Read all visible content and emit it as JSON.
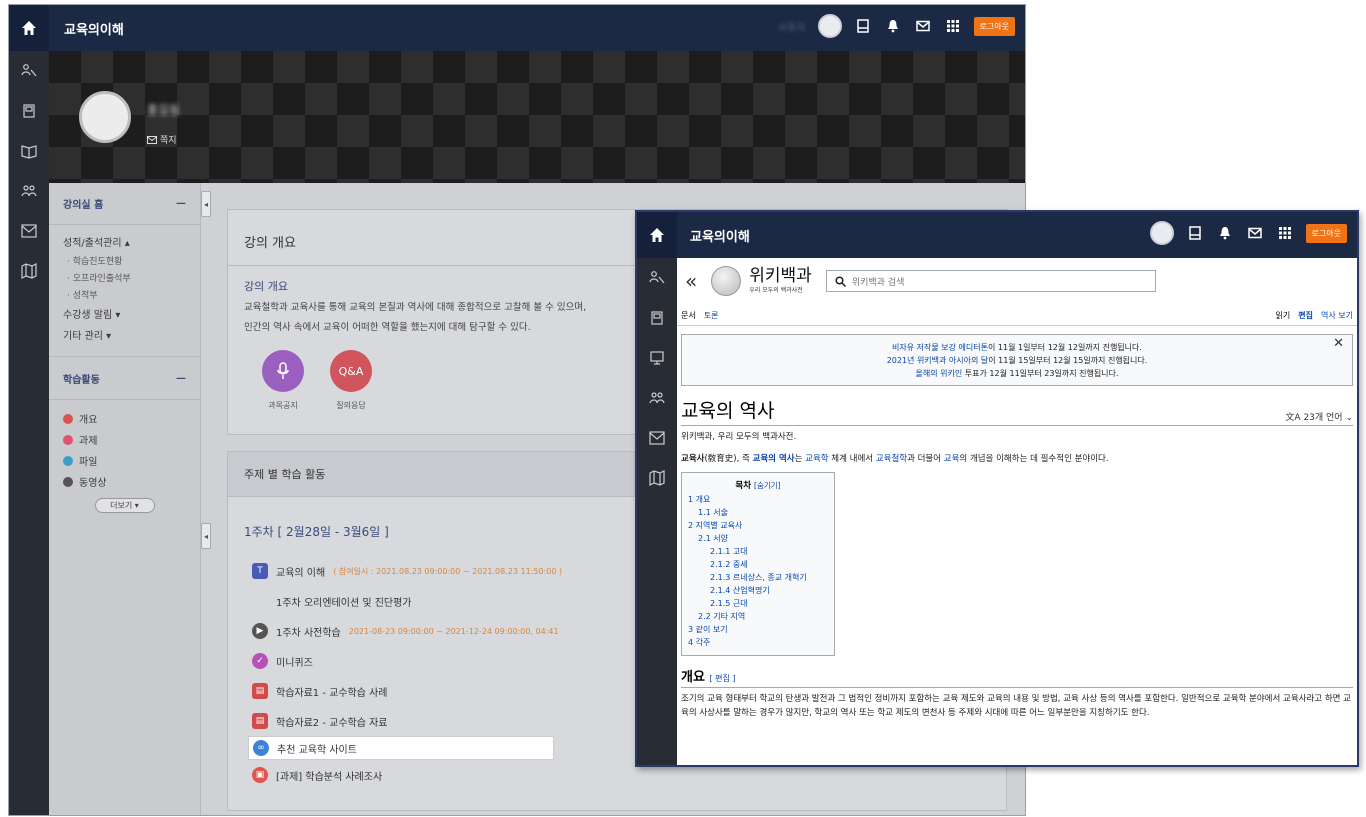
{
  "lms": {
    "app_title": "교육의이해",
    "user_name": "사용자",
    "logout_label": "로그아웃",
    "banner": {
      "name": "홍길동",
      "note_label": "쪽지"
    },
    "nav": {
      "home_label": "강의실 홈",
      "home_toggle": "—",
      "grades_label": "성적/출석관리 ▴",
      "grades_sub": [
        "· 학습진도현황",
        "· 오프라인출석부",
        "· 성적부"
      ],
      "notify_label": "수강생 알림 ▾",
      "etc_label": "기타 관리 ▾",
      "activities_label": "학습활동",
      "activities_toggle": "—",
      "activities": [
        "개요",
        "과제",
        "파일",
        "동영상"
      ],
      "more_label": "더보기 ▾"
    },
    "overview": {
      "title": "강의 개요",
      "subtitle": "강의 개요",
      "text1": "교육철학과 교육사를 통해 교육의 본질과 역사에 대해 종합적으로 고찰해 볼 수 있으며,",
      "text2": "인간의 역사 속에서 교육이 어떠한 역할을 했는지에 대해 탐구할 수 있다.",
      "btn1_label": "과목공지",
      "btn2_text": "Q&A",
      "btn2_label": "질의응답"
    },
    "weekly": {
      "header": "주제 별 학습 활동",
      "week": "1주차 [ 2월28일 - 3월6일 ]",
      "items": {
        "i1_title": "교육의 이해",
        "i1_meta": "( 참여일시 : 2021.08.23 09:00:00 ~ 2021.08.23 11:50:00 )",
        "i1_sub": "1주차 오리엔테이션 및 진단평가",
        "i2_title": "1주차 사전학습",
        "i2_meta": "2021-08-23 09:00:00 ~ 2021-12-24 09:00:00, 04:41",
        "i3_title": "미니퀴즈",
        "i4_title": "학습자료1 - 교수학습 사례",
        "i5_title": "학습자료2 - 교수학습 자료",
        "i6_title": "추천 교육학 사이트",
        "i7_title": "[과제] 학습분석 사례조사"
      }
    }
  },
  "front": {
    "app_title": "교육의이해",
    "logout_label": "로그아웃",
    "wiki": {
      "back": "«",
      "title": "위키백과",
      "subtitle": "우리 모두의 백과사전",
      "search_placeholder": "위키백과 검색",
      "tab_doc": "문서",
      "tab_talk": "토론",
      "tab_read": "읽기",
      "tab_edit": "편집",
      "tab_history": "역사 보기",
      "notice1_link": "비자유 저작물 보강 에디터톤",
      "notice1_rest": "이 11월 1일부터 12월 12일까지 진행됩니다.",
      "notice2_link": "2021년 위키백과 아시아의 달",
      "notice2_rest": "이 11월 15일부터 12월 15일까지 진행됩니다.",
      "notice3_link": "올해의 위키인",
      "notice3_rest": " 투표가 12월 11일부터 23일까지 진행됩니다.",
      "heading": "교육의 역사",
      "lang": "23개 언어",
      "from": "위키백과, 우리 모두의 백과사전.",
      "lead_a": "교육사",
      "lead_b": "(敎育史), 즉 ",
      "lead_c": "교육의 역사",
      "lead_d": "는 ",
      "lead_e": "교육학",
      "lead_f": " 체계 내에서 ",
      "lead_g": "교육철학",
      "lead_h": "과 더불어 ",
      "lead_i": "교육",
      "lead_j": "의 개념을 이해하는 데 필수적인 분야이다.",
      "toc_title": "목차",
      "toc_hide": "[숨기기]",
      "toc": [
        "1 개요",
        "1.1 서술",
        "2 지역별 교육사",
        "2.1 서양",
        "2.1.1 고대",
        "2.1.2 중세",
        "2.1.3 르네상스, 종교 개혁기",
        "2.1.4 산업혁명기",
        "2.1.5 근대",
        "2.2 기타 지역",
        "3 같이 보기",
        "4 각주"
      ],
      "section": "개요",
      "section_edit": "[ 편집 ]",
      "body": "조기의 교육 형태부터 학교의 탄생과 발전과 그 법적인 정비까지 포함하는 교육 제도와 교육의 내용 및 방법, 교육 사상 등의 역사를 포함한다. 일반적으로 교육학 분야에서 교육사라고 하면 교육의 사상사를 말하는 경우가 많지만, 학교의 역사 또는 학교 제도의 변천사 등 주제와 시대에 따른 어느 일부분만을 지칭하기도 한다."
    }
  },
  "colors": {
    "topbar": "#1c2944",
    "rail": "#282c35",
    "logout": "#f07316",
    "wiki_link": "#0645ad"
  }
}
